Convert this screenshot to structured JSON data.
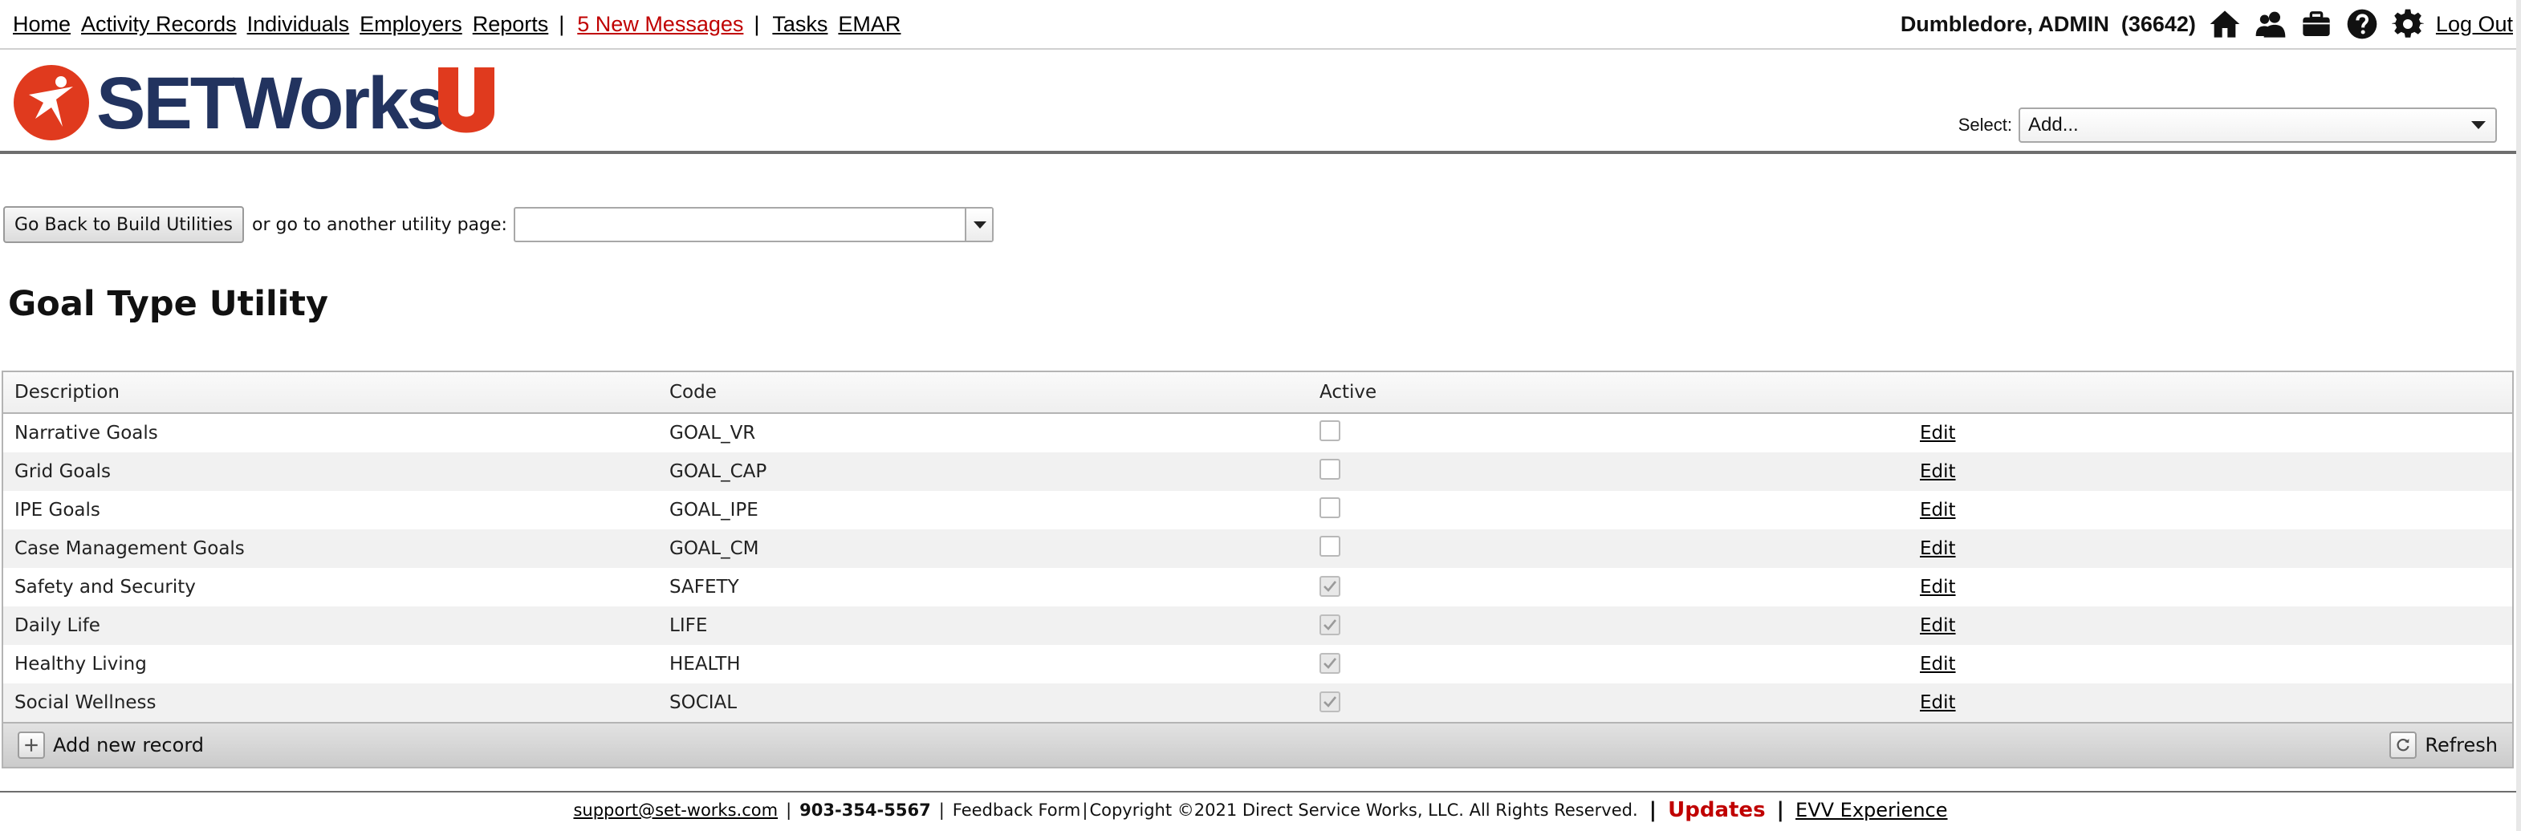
{
  "nav": {
    "links": [
      "Home",
      "Activity Records",
      "Individuals",
      "Employers",
      "Reports"
    ],
    "separator": "|",
    "messages": "5 New Messages",
    "links_after": [
      "Tasks",
      "EMAR"
    ],
    "user": "Dumbledore, ADMIN",
    "user_id": "(36642)",
    "icons": [
      "home-icon",
      "users-icon",
      "briefcase-icon",
      "help-icon",
      "gear-icon"
    ],
    "logout": "Log Out"
  },
  "header": {
    "logo_text": "SETWorks",
    "select_label": "Select:",
    "select_value": "Add..."
  },
  "utility": {
    "back_button": "Go Back to Build Utilities",
    "goto_text": "or go to another utility page:",
    "goto_value": ""
  },
  "page_title": "Goal Type Utility",
  "grid": {
    "columns": [
      "Description",
      "Code",
      "Active",
      ""
    ],
    "rows": [
      {
        "description": "Narrative Goals",
        "code": "GOAL_VR",
        "active": false,
        "edit": "Edit"
      },
      {
        "description": "Grid Goals",
        "code": "GOAL_CAP",
        "active": false,
        "edit": "Edit"
      },
      {
        "description": "IPE Goals",
        "code": "GOAL_IPE",
        "active": false,
        "edit": "Edit"
      },
      {
        "description": "Case Management Goals",
        "code": "GOAL_CM",
        "active": false,
        "edit": "Edit"
      },
      {
        "description": "Safety and Security",
        "code": "SAFETY",
        "active": true,
        "edit": "Edit"
      },
      {
        "description": "Daily Life",
        "code": "LIFE",
        "active": true,
        "edit": "Edit"
      },
      {
        "description": "Healthy Living",
        "code": "HEALTH",
        "active": true,
        "edit": "Edit"
      },
      {
        "description": "Social Wellness",
        "code": "SOCIAL",
        "active": true,
        "edit": "Edit"
      }
    ],
    "add_record": "Add new record",
    "refresh": "Refresh"
  },
  "footer": {
    "email": "support@set-works.com",
    "phone": "903-354-5567",
    "feedback": "Feedback Form",
    "copyright": "Copyright ©2021 Direct Service Works, LLC. All Rights Reserved.",
    "updates": "Updates",
    "evv": "EVV Experience"
  },
  "colors": {
    "brand_red": "#e03a1e",
    "brand_navy": "#22335f",
    "message_red": "#c00000"
  }
}
